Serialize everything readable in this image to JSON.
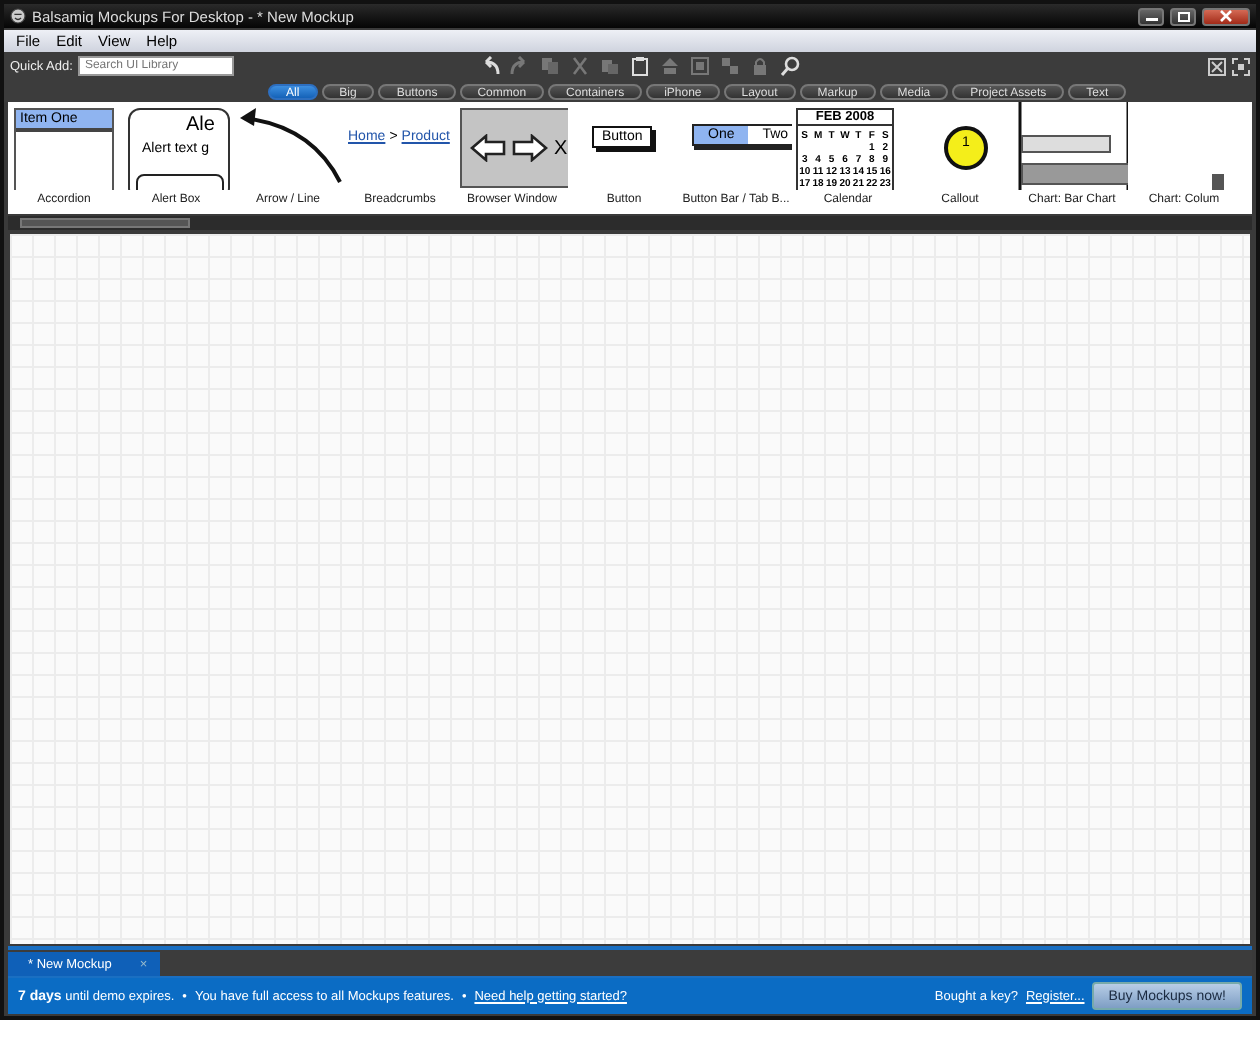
{
  "window": {
    "title": "Balsamiq Mockups For Desktop - * New Mockup"
  },
  "menu": [
    "File",
    "Edit",
    "View",
    "Help"
  ],
  "quick_add": {
    "label": "Quick Add:",
    "placeholder": "Search UI Library"
  },
  "filter_tabs": [
    {
      "label": "All",
      "selected": true
    },
    {
      "label": "Big",
      "selected": false
    },
    {
      "label": "Buttons",
      "selected": false
    },
    {
      "label": "Common",
      "selected": false
    },
    {
      "label": "Containers",
      "selected": false
    },
    {
      "label": "iPhone",
      "selected": false
    },
    {
      "label": "Layout",
      "selected": false
    },
    {
      "label": "Markup",
      "selected": false
    },
    {
      "label": "Media",
      "selected": false
    },
    {
      "label": "Project Assets",
      "selected": false
    },
    {
      "label": "Text",
      "selected": false
    }
  ],
  "library": [
    {
      "kind": "accordion",
      "label": "Accordion",
      "preview": {
        "items": [
          {
            "label": "Item One",
            "selected": true
          }
        ]
      }
    },
    {
      "kind": "alert",
      "label": "Alert Box",
      "preview": {
        "title": "Ale",
        "text": "Alert text g"
      }
    },
    {
      "kind": "arrow",
      "label": "Arrow / Line"
    },
    {
      "kind": "breadcrumbs",
      "label": "Breadcrumbs",
      "preview": {
        "links": [
          "Home",
          "Product"
        ],
        "separator": ">"
      }
    },
    {
      "kind": "browser",
      "label": "Browser Window",
      "preview": {
        "close": "X"
      }
    },
    {
      "kind": "button",
      "label": "Button",
      "preview": {
        "text": "Button"
      }
    },
    {
      "kind": "buttonbar",
      "label": "Button Bar / Tab B...",
      "preview": {
        "segments": [
          {
            "label": "One",
            "selected": true
          },
          {
            "label": "Two",
            "selected": false
          }
        ]
      }
    },
    {
      "kind": "calendar",
      "label": "Calendar",
      "preview": {
        "month": "FEB 2008",
        "weekdays": [
          "S",
          "M",
          "T",
          "W",
          "T",
          "F",
          "S"
        ],
        "rows": [
          [
            "",
            "",
            "",
            "",
            "",
            "1",
            "2"
          ],
          [
            "3",
            "4",
            "5",
            "6",
            "7",
            "8",
            "9"
          ],
          [
            "10",
            "11",
            "12",
            "13",
            "14",
            "15",
            "16"
          ],
          [
            "17",
            "18",
            "19",
            "20",
            "21",
            "22",
            "23"
          ]
        ]
      }
    },
    {
      "kind": "callout",
      "label": "Callout",
      "preview": {
        "text": "1"
      }
    },
    {
      "kind": "barchart",
      "label": "Chart: Bar Chart"
    },
    {
      "kind": "columnchart",
      "label": "Chart: Colum"
    }
  ],
  "document_tabs": [
    {
      "label": "* New Mockup",
      "close": "×",
      "selected": true
    }
  ],
  "status_bar": {
    "days": "7 days",
    "expires": "until demo expires.",
    "bullet": "•",
    "access": "You have full access to all Mockups features.",
    "help_link": "Need help getting started?",
    "key_question": "Bought a key?",
    "register_link": "Register...",
    "buy_button": "Buy Mockups now!"
  }
}
